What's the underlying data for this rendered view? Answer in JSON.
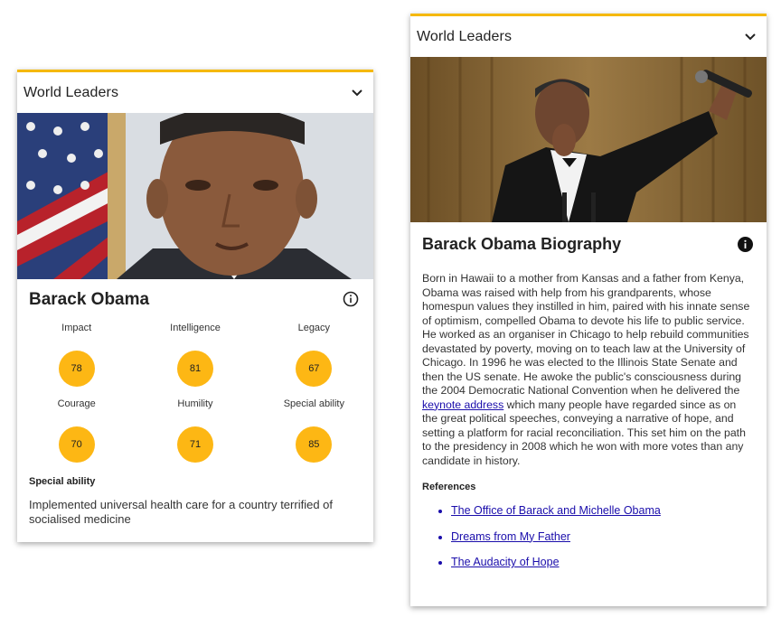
{
  "left_card": {
    "header_title": "World Leaders",
    "name": "Barack Obama",
    "stats": [
      {
        "label": "Impact",
        "value": "78"
      },
      {
        "label": "Intelligence",
        "value": "81"
      },
      {
        "label": "Legacy",
        "value": "67"
      },
      {
        "label": "Courage",
        "value": "70"
      },
      {
        "label": "Humility",
        "value": "71"
      },
      {
        "label": "Special ability",
        "value": "85"
      }
    ],
    "special_ability_title": "Special ability",
    "special_ability_text": "Implemented universal health care for a country terrified of socialised medicine"
  },
  "right_card": {
    "header_title": "World Leaders",
    "bio_title": "Barack Obama Biography",
    "bio_before_link": "Born in Hawaii to a mother from Kansas and a father from Kenya, Obama was raised with help from his grandparents, whose homespun values they instilled in him, paired with his innate sense of optimism, compelled Obama to devote his life to public service. He worked as an organiser in Chicago to help rebuild communities devastated by poverty, moving on to teach law at the University of Chicago. In 1996 he was elected to the Illinois State Senate and then the US senate. He awoke the public's consciousness during the 2004 Democratic National Convention when he delivered the ",
    "bio_link": "keynote address",
    "bio_after_link": " which many people have regarded since as on the great political speeches, conveying a narrative of hope, and setting a platform for racial reconciliation. This set him on the path to the presidency in 2008 which he won with more votes than any candidate in history.",
    "references_title": "References",
    "references": [
      "The Office of Barack and Michelle Obama",
      "Dreams from My Father",
      "The Audacity of Hope"
    ]
  },
  "colors": {
    "accent_border": "#f5b800",
    "stat_circle": "#fdb714",
    "link": "#1a0dab"
  },
  "icons": [
    "chevron-down-icon",
    "info-outline-icon",
    "info-filled-icon"
  ]
}
